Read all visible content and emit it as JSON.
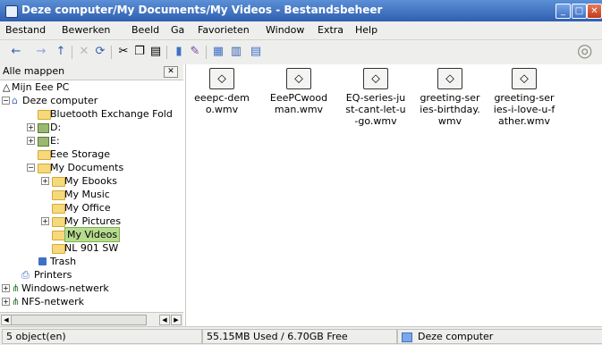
{
  "window": {
    "title": "Deze computer/My Documents/My Videos - Bestandsbeheer",
    "buttons": {
      "minimize": "_",
      "maximize": "□",
      "close": "✕"
    }
  },
  "menubar": [
    "Bestand",
    "Bewerken",
    "Beeld",
    "Ga",
    "Favorieten",
    "Window",
    "Extra",
    "Help"
  ],
  "toolbar": {
    "icons": [
      "back-icon",
      "forward-icon",
      "up-icon",
      "cut-icon",
      "reload-icon",
      "scissors-icon",
      "copy-icon",
      "paste-icon",
      "trash-icon",
      "properties-icon",
      "view-icon",
      "view-list-icon",
      "view-detail-icon"
    ],
    "glyphs": {
      "back": "←",
      "forward": "→",
      "up": "↑",
      "stop": "✕",
      "reload": "⟳",
      "cut": "✂",
      "copy": "❐",
      "paste": "▤",
      "trash": "▮",
      "props": "✎",
      "view1": "▦",
      "view2": "▥",
      "view3": "▤",
      "spinner": "◎"
    }
  },
  "sidebar": {
    "header": "Alle mappen",
    "close": "✕",
    "tree": [
      {
        "label": "Mijn Eee PC"
      },
      {
        "label": "Deze computer"
      },
      {
        "label": "Bluetooth Exchange Fold"
      },
      {
        "label": "D:"
      },
      {
        "label": "E:"
      },
      {
        "label": "Eee Storage"
      },
      {
        "label": "My Documents"
      },
      {
        "label": "My Ebooks"
      },
      {
        "label": "My Music"
      },
      {
        "label": "My Office"
      },
      {
        "label": "My Pictures"
      },
      {
        "label": "My Videos"
      },
      {
        "label": "NL 901 SW"
      },
      {
        "label": "Trash"
      },
      {
        "label": "Printers"
      },
      {
        "label": "Windows-netwerk"
      },
      {
        "label": "NFS-netwerk"
      }
    ],
    "scroll_arrows": {
      "left": "◀",
      "right": "▶"
    }
  },
  "files": [
    {
      "name": "eeepc-dem\no.wmv"
    },
    {
      "name": "EeePCwood\nman.wmv"
    },
    {
      "name": "EQ-series-ju\nst-cant-let-u\n-go.wmv"
    },
    {
      "name": "greeting-ser\nies-birthday.\nwmv"
    },
    {
      "name": "greeting-ser\nies-i-love-u-f\nather.wmv"
    }
  ],
  "status": {
    "objects": "5 object(en)",
    "space": "55.15MB Used / 6.70GB Free",
    "location": "Deze computer"
  }
}
